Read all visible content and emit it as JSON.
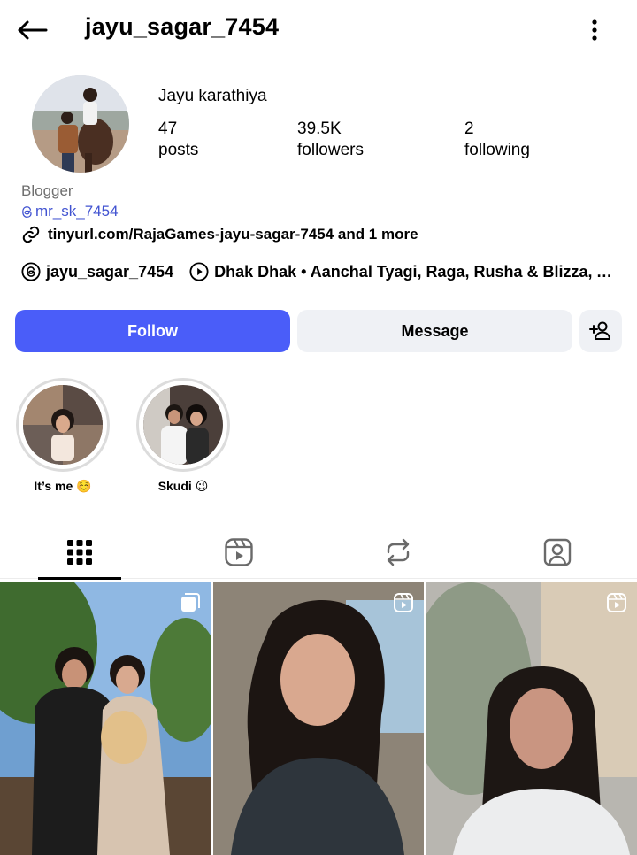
{
  "header": {
    "username": "jayu_sagar_7454",
    "back_icon": "back-arrow-icon",
    "menu_icon": "more-vertical-icon"
  },
  "profile": {
    "full_name": "Jayu karathiya",
    "stats": [
      {
        "value": "47",
        "label": "posts"
      },
      {
        "value": "39.5K",
        "label": "followers"
      },
      {
        "value": "2",
        "label": "following"
      }
    ],
    "category": "Blogger",
    "threads_handle": "mr_sk_7454",
    "link": "tinyurl.com/RajaGames-jayu-sagar-7454 and 1 more",
    "threads_pill": "jayu_sagar_7454",
    "music": "Dhak Dhak • Aanchal Tyagi, Raga, Rusha & Blizza, Ab..."
  },
  "actions": {
    "follow_label": "Follow",
    "message_label": "Message",
    "add_user_icon": "add-person-icon"
  },
  "highlights": [
    {
      "label": "It’s me ☺️"
    },
    {
      "label": "Skudi 😉"
    }
  ],
  "tabs": [
    {
      "name": "posts-grid",
      "icon": "grid-icon",
      "active": true
    },
    {
      "name": "reels",
      "icon": "reels-icon",
      "active": false
    },
    {
      "name": "reposts",
      "icon": "repost-icon",
      "active": false
    },
    {
      "name": "tagged",
      "icon": "tagged-person-icon",
      "active": false
    }
  ],
  "posts": [
    {
      "badge": "carousel-icon"
    },
    {
      "badge": "reel-icon"
    },
    {
      "badge": "reel-icon"
    }
  ],
  "colors": {
    "follow_button": "#4a5df9",
    "secondary_button": "#eff1f5",
    "link_blue": "#4153d1",
    "muted_text": "#6f6f6f"
  }
}
